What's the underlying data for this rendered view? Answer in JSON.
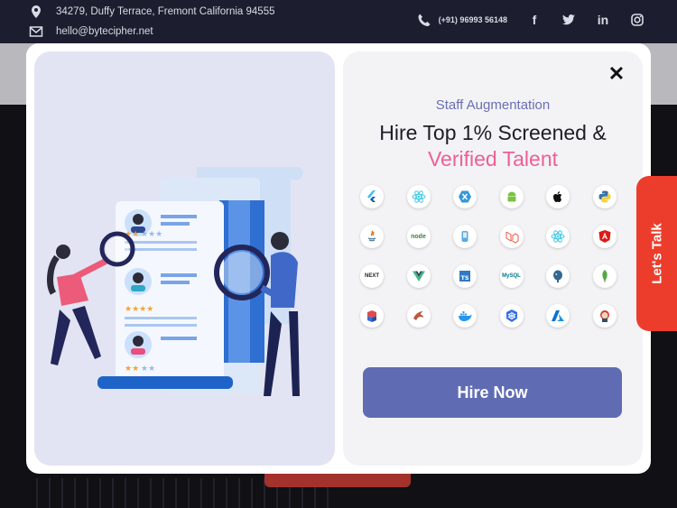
{
  "topbar": {
    "address": "34279, Duffy Terrace, Fremont California 94555",
    "email": "hello@bytecipher.net",
    "phone": "(+91) 96993 56148",
    "social": [
      "facebook-icon",
      "twitter-icon",
      "linkedin-icon",
      "instagram-icon"
    ]
  },
  "popup": {
    "subtitle": "Staff Augmentation",
    "title_line1": "Hire Top 1% Screened &",
    "title_line2": "Verified Talent",
    "cta_label": "Hire Now",
    "close_label": "✕",
    "tech_icons": [
      "flutter-icon",
      "react-icon",
      "xamarin-icon",
      "android-icon",
      "apple-icon",
      "python-icon",
      "java-icon",
      "nodejs-icon",
      "kotlin-icon",
      "laravel-icon",
      "react-native-icon",
      "angular-icon",
      "nextjs-icon",
      "vue-icon",
      "typescript-icon",
      "mysql-icon",
      "postgresql-icon",
      "mongodb-icon",
      "aws-icon",
      "scala-icon",
      "docker-icon",
      "kubernetes-icon",
      "azure-icon",
      "jenkins-icon"
    ]
  },
  "side_tab": {
    "label": "Let's Talk"
  },
  "colors": {
    "topbar": "#1c1d2e",
    "accent_blue": "#5f6cb4",
    "accent_pink": "#ee5f94",
    "side_tab": "#ec3d2c"
  }
}
